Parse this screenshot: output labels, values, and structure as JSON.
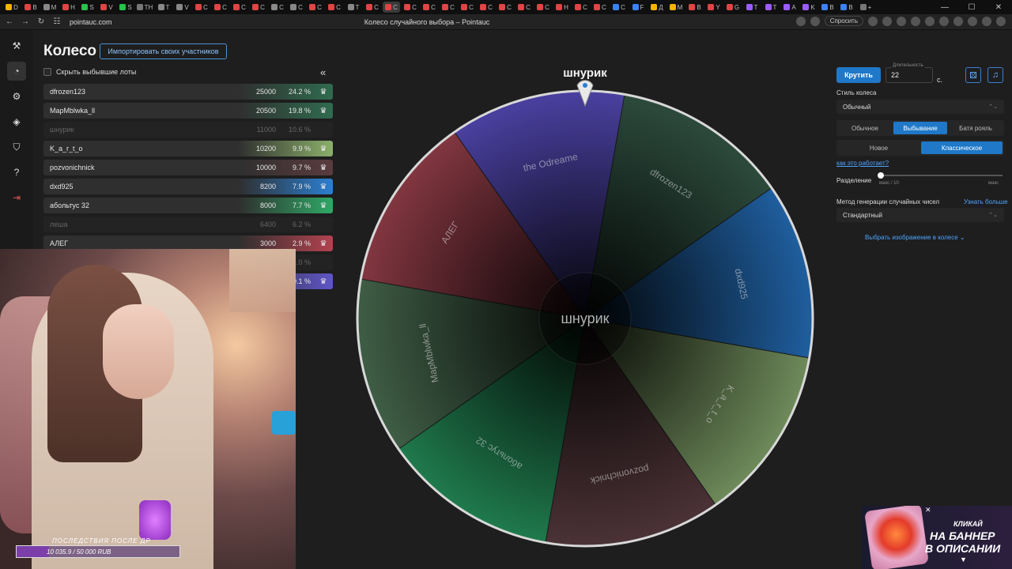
{
  "browser": {
    "url": "pointauc.com",
    "title": "Колесо случайного выбора – Pointauc",
    "ask_label": "Спросить",
    "tabs": [
      "D",
      "B",
      "M",
      "H",
      "S",
      "V",
      "S",
      "TH",
      "T",
      "V",
      "C",
      "C",
      "C",
      "C",
      "C",
      "C",
      "C",
      "C",
      "T",
      "C",
      "C",
      "C",
      "C",
      "C",
      "C",
      "C",
      "C",
      "C",
      "C",
      "H",
      "C",
      "C",
      "C",
      "F",
      "Д",
      "M",
      "B",
      "Y",
      "G",
      "T",
      "T",
      "A",
      "K",
      "B",
      "B",
      "+"
    ],
    "tab_colors": [
      "#f5b400",
      "#e04444",
      "#888",
      "#e04444",
      "#27c24c",
      "#e04444",
      "#27c24c",
      "#777",
      "#888",
      "#888",
      "#e04444",
      "#e04444",
      "#e04444",
      "#e04444",
      "#888",
      "#888",
      "#e04444",
      "#e04444",
      "#888",
      "#e04444",
      "#e04444",
      "#e04444",
      "#e04444",
      "#e04444",
      "#e04444",
      "#e04444",
      "#e04444",
      "#e04444",
      "#e04444",
      "#e04444",
      "#e04444",
      "#e04444",
      "#3b82f6",
      "#3b82f6",
      "#f5b400",
      "#f5b400",
      "#e04444",
      "#e04444",
      "#e04444",
      "#9b5cff",
      "#9b5cff",
      "#9b5cff",
      "#9b5cff",
      "#3b82f6",
      "#3b82f6",
      "#777"
    ],
    "window_controls": [
      "—",
      "☐",
      "✕"
    ]
  },
  "sidebar": {
    "icons": [
      "hammer-icon",
      "wheel-icon",
      "gear-icon",
      "layers-icon",
      "shield-icon",
      "help-icon",
      "logout-icon"
    ],
    "glyphs": [
      "⚒",
      "◔",
      "⚙",
      "◈",
      "⛉",
      "?",
      "⇥"
    ]
  },
  "main": {
    "heading": "Колесо",
    "import_button": "Импортировать своих участников",
    "hide_checkbox_label": "Скрыть выбывшие лоты",
    "collapse_glyph": "«"
  },
  "lots": [
    {
      "name": "dfrozen123",
      "amount": "25000",
      "percent": "24.2 %",
      "color": "#2f6b4f",
      "out": false
    },
    {
      "name": "MapMblwka_ll",
      "amount": "20500",
      "percent": "19.8 %",
      "color": "#2f6b4f",
      "out": false
    },
    {
      "name": "шнурик",
      "amount": "11000",
      "percent": "10.6 %",
      "color": "",
      "out": true
    },
    {
      "name": "K_a_r_t_o",
      "amount": "10200",
      "percent": "9.9 %",
      "color": "#8bb06a",
      "out": false
    },
    {
      "name": "pozvonichnick",
      "amount": "10000",
      "percent": "9.7 %",
      "color": "#5a3b3e",
      "out": false
    },
    {
      "name": "dxd925",
      "amount": "8200",
      "percent": "7.9 %",
      "color": "#2b7fd1",
      "out": false
    },
    {
      "name": "абольтус 32",
      "amount": "8000",
      "percent": "7.7 %",
      "color": "#2fa866",
      "out": false
    },
    {
      "name": "леша",
      "amount": "6400",
      "percent": "6.2 %",
      "color": "",
      "out": true
    },
    {
      "name": "АЛЕГ",
      "amount": "3000",
      "percent": "2.9 %",
      "color": "#b3424f",
      "out": false
    },
    {
      "name": "",
      "amount": "",
      "percent": "1.0 %",
      "color": "",
      "out": true
    },
    {
      "name": "",
      "amount": "",
      "percent": "0.1 %",
      "color": "#5f55c8",
      "out": false
    }
  ],
  "webcam": {
    "caption": "ПОСЛЕДСТВИЯ ПОСЛЕ ДР",
    "progress_text": "10 035.9 / 50 000 RUB",
    "progress_fraction": 0.2
  },
  "wheel": {
    "winner": "шнурик",
    "center_text": "шнурик",
    "segments": [
      {
        "name": "dfrozen123",
        "color": "#2c4a3c"
      },
      {
        "name": "dxd925",
        "color": "#1f5e9e"
      },
      {
        "name": "K_a_r_t_o",
        "color": "#6e8a5a"
      },
      {
        "name": "pozvonichnick",
        "color": "#4b3236"
      },
      {
        "name": "абольтус 32",
        "color": "#1f7a4c"
      },
      {
        "name": "MapMblwka_ll",
        "color": "#3f5d45"
      },
      {
        "name": "АЛЕГ",
        "color": "#823640"
      },
      {
        "name": "the Odreame",
        "color": "#4a40a0"
      }
    ]
  },
  "controls": {
    "spin_button": "Крутить",
    "duration_label": "Длительность",
    "duration_value": "22",
    "duration_unit": "с.",
    "dice_icon": "dice-icon",
    "music_icon": "music-icon",
    "style_label": "Стиль колеса",
    "style_value": "Обычный",
    "modes": [
      "Обычное",
      "Выбывание",
      "Батя рояль"
    ],
    "mode_selected": 1,
    "variants": [
      "Новое",
      "Классическое"
    ],
    "variant_selected": 1,
    "how_link": "как это работает?",
    "split_label": "Разделение",
    "split_min": "макс / 10",
    "split_max": "макс",
    "split_value": 0,
    "rng_label": "Метод генерации случайных чисел",
    "rng_more": "Узнать больше",
    "rng_value": "Стандартный",
    "image_link": "Выбрать изображение в колесе"
  },
  "banner": {
    "line1": "КЛИКАЙ",
    "line2": "НА БАННЕР",
    "line3": "В ОПИСАНИИ",
    "close": "✕"
  }
}
